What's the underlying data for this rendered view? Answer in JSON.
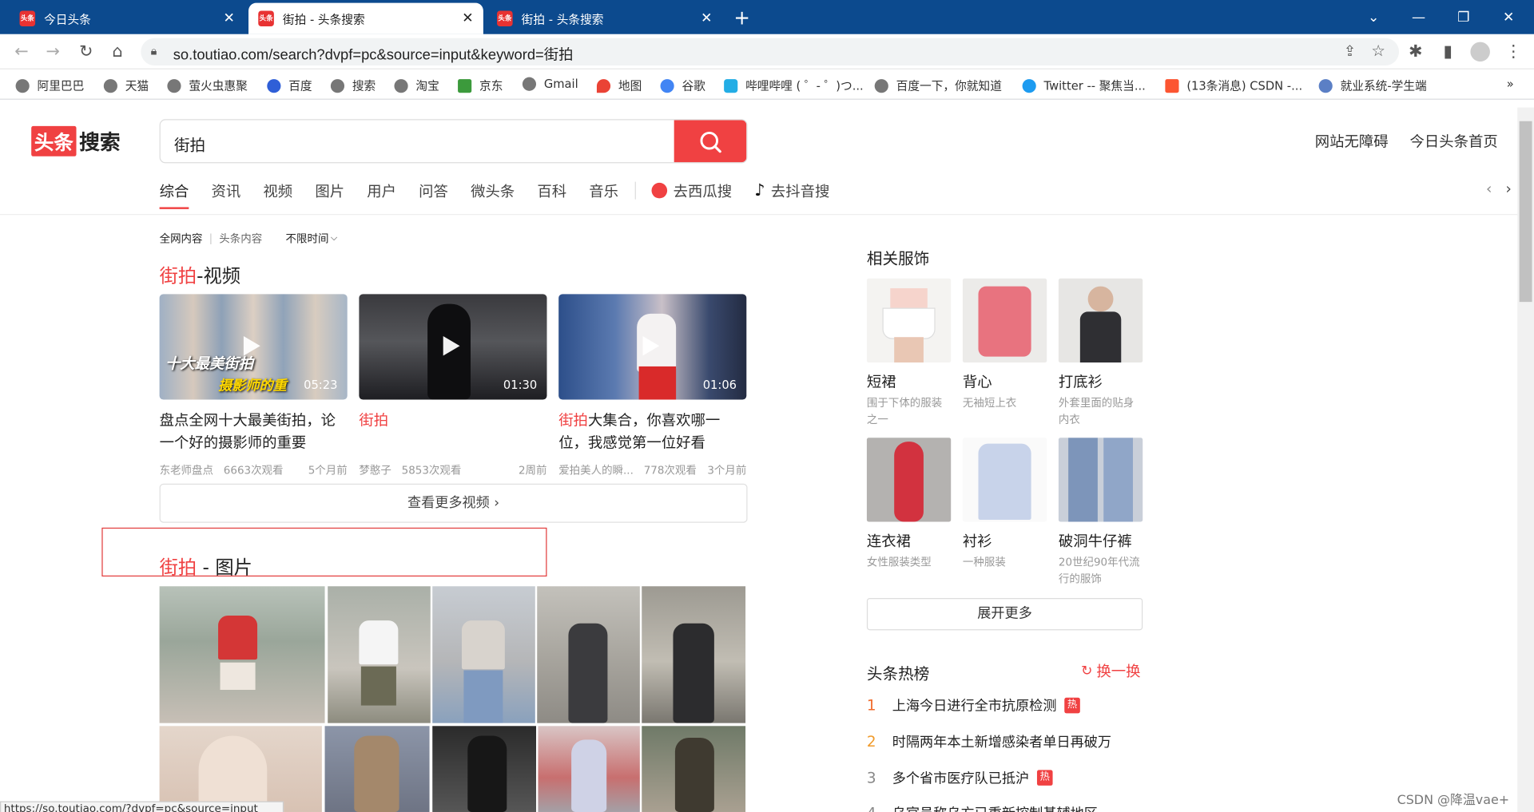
{
  "browser": {
    "tabs": [
      {
        "title": "今日头条",
        "fav": "头条"
      },
      {
        "title": "街拍 - 头条搜索",
        "fav": "头条"
      },
      {
        "title": "街拍 - 头条搜索",
        "fav": "头条"
      }
    ],
    "new_tab": "+",
    "url": "so.toutiao.com/search?dvpf=pc&source=input&keyword=街拍",
    "bookmarks": [
      "阿里巴巴",
      "天猫",
      "萤火虫惠聚",
      "百度",
      "搜索",
      "淘宝",
      "京东",
      "Gmail",
      "地图",
      "谷歌",
      "哔哩哔哩 ( ゜- ゜)つ...",
      "百度一下，你就知道",
      "Twitter -- 聚焦当...",
      "(13条消息) CSDN -...",
      "就业系统-学生端"
    ],
    "bookmarks_more": "»"
  },
  "header": {
    "logo_box": "头条",
    "logo_text": "搜索",
    "query": "街拍",
    "links": [
      "网站无障碍",
      "今日头条首页"
    ],
    "tabs": [
      "综合",
      "资讯",
      "视频",
      "图片",
      "用户",
      "问答",
      "微头条",
      "百科",
      "音乐"
    ],
    "ext_tabs": [
      "去西瓜搜",
      "去抖音搜"
    ]
  },
  "filters": {
    "scope_all": "全网内容",
    "scope_toutiao": "头条内容",
    "time": "不限时间"
  },
  "video_section": {
    "kw": "街拍",
    "suffix": "-视频",
    "videos": [
      {
        "overlay1": "十大最美街拍",
        "overlay2": "摄影师的重",
        "duration": "05:23",
        "title": "盘点全网十大最美街拍，论一个好的摄影师的重要性，...",
        "title_hl": "",
        "author": "东老师盘点",
        "views": "6663次观看",
        "time": "5个月前"
      },
      {
        "duration": "01:30",
        "title": "",
        "title_hl": "街拍",
        "author": "梦憨子",
        "views": "5853次观看",
        "time": "2周前"
      },
      {
        "duration": "01:06",
        "title": "大集合，你喜欢哪一位，我感觉第一位好看",
        "title_hl": "街拍",
        "author": "爱拍美人的瞬...",
        "views": "778次观看",
        "time": "3个月前"
      }
    ],
    "more": "查看更多视频"
  },
  "image_section": {
    "kw": "街拍",
    "suffix": " - 图片"
  },
  "related": {
    "title": "相关服饰",
    "items": [
      {
        "name": "短裙",
        "desc": "围于下体的服装之一"
      },
      {
        "name": "背心",
        "desc": "无袖短上衣"
      },
      {
        "name": "打底衫",
        "desc": "外套里面的贴身内衣"
      },
      {
        "name": "连衣裙",
        "desc": "女性服装类型"
      },
      {
        "name": "衬衫",
        "desc": "一种服装"
      },
      {
        "name": "破洞牛仔裤",
        "desc": "20世纪90年代流行的服饰"
      }
    ],
    "expand": "展开更多"
  },
  "hot": {
    "title": "头条热榜",
    "refresh": "换一换",
    "items": [
      {
        "rank": "1",
        "text": "上海今日进行全市抗原检测",
        "badge": "热"
      },
      {
        "rank": "2",
        "text": "时隔两年本土新增感染者单日再破万",
        "badge": ""
      },
      {
        "rank": "3",
        "text": "多个省市医疗队已抵沪",
        "badge": "热"
      },
      {
        "rank": "4",
        "text": "乌官员称乌方已重新控制基辅地区",
        "badge": ""
      }
    ]
  },
  "statusbar": "https://so.toutiao.com/?dvpf=pc&source=input",
  "watermark": "CSDN @降温vae+",
  "colors": {
    "accent": "#f04142",
    "tabstrip": "#0c4a8e"
  }
}
